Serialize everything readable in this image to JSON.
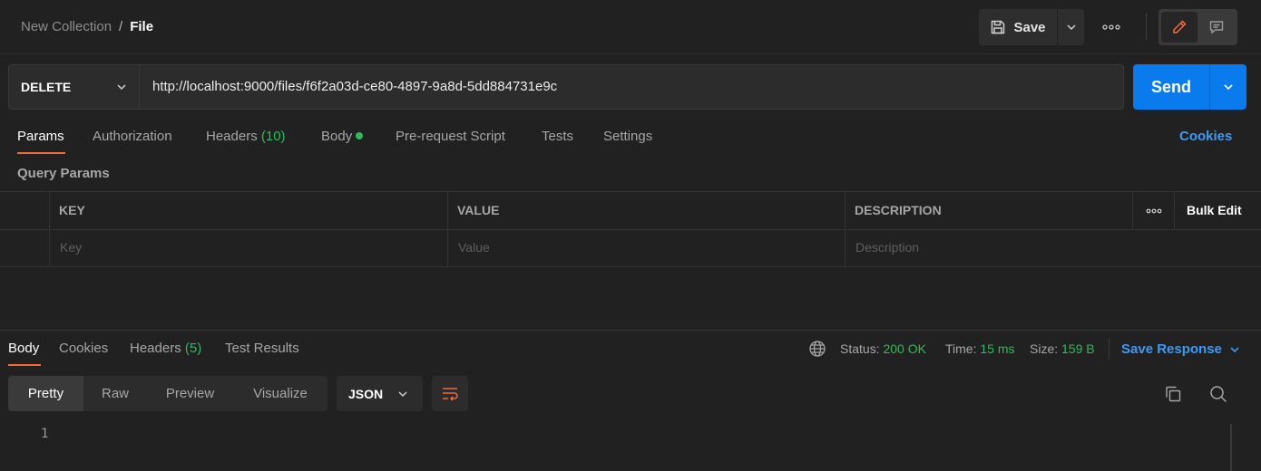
{
  "breadcrumb": {
    "collection": "New Collection",
    "separator": "/",
    "request": "File"
  },
  "toolbar": {
    "save_label": "Save"
  },
  "request": {
    "method": "DELETE",
    "url": "http://localhost:9000/files/f6f2a03d-ce80-4897-9a8d-5dd884731e9c",
    "send_label": "Send"
  },
  "request_tabs": {
    "params": "Params",
    "authorization": "Authorization",
    "headers": "Headers",
    "headers_count": "(10)",
    "body": "Body",
    "prerequest": "Pre-request Script",
    "tests": "Tests",
    "settings": "Settings",
    "cookies": "Cookies"
  },
  "query_params": {
    "label": "Query Params",
    "columns": {
      "key": "KEY",
      "value": "VALUE",
      "description": "DESCRIPTION"
    },
    "bulk_edit": "Bulk Edit",
    "placeholders": {
      "key": "Key",
      "value": "Value",
      "description": "Description"
    }
  },
  "response": {
    "tabs": {
      "body": "Body",
      "cookies": "Cookies",
      "headers": "Headers",
      "headers_count": "(5)",
      "test_results": "Test Results"
    },
    "status_label": "Status:",
    "status_value": "200 OK",
    "time_label": "Time:",
    "time_value": "15 ms",
    "size_label": "Size:",
    "size_value": "159 B",
    "save_response": "Save Response",
    "views": {
      "pretty": "Pretty",
      "raw": "Raw",
      "preview": "Preview",
      "visualize": "Visualize"
    },
    "format": "JSON",
    "line_number": "1"
  },
  "colors": {
    "accent_orange": "#f26b3a",
    "send_blue": "#097bed",
    "link_blue": "#3d9bf5",
    "success_green": "#2dbb5c"
  }
}
